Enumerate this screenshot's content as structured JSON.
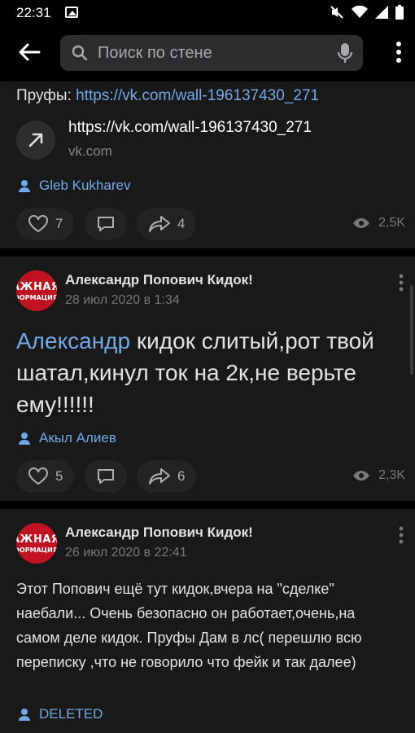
{
  "status_bar": {
    "time": "22:31"
  },
  "search": {
    "placeholder": "Поиск по стене"
  },
  "post1": {
    "proofs_label": "Пруфы:",
    "proofs_link": "https://vk.com/wall-196137430_271",
    "link_title": "https://vk.com/wall-196137430_271",
    "link_domain": "vk.com",
    "author": "Gleb Kukharev",
    "likes": "7",
    "shares": "4",
    "views": "2,5K"
  },
  "post2": {
    "avatar_line1": "АЖНАЯ",
    "avatar_line2": "ФОРМАЦИЯ",
    "name": "Александр Попович Кидок!",
    "date": "28 июл 2020 в 1:34",
    "mention": "Александр",
    "text": " кидок слитый,рот твой шатал,кинул ток на 2к,не верьте ему!!!!!!",
    "author": "Акыл Алиев",
    "likes": "5",
    "shares": "6",
    "views": "2,3K"
  },
  "post3": {
    "avatar_line1": "АЖНАЯ",
    "avatar_line2": "ФОРМАЦИЯ",
    "name": "Александр Попович Кидок!",
    "date": "26 июл 2020 в 22:41",
    "text": "Этот Попович ещё тут кидок,вчера на \"сделке\" наебали... Очень безопасно он работает,очень,на самом деле кидок. Пруфы Дам в лс( перешлю всю переписку ,что не говорило что фейк и так далее)",
    "author": "DELETED"
  },
  "colors": {
    "link": "#71aaeb",
    "card": "#19191a",
    "background": "#000000"
  }
}
